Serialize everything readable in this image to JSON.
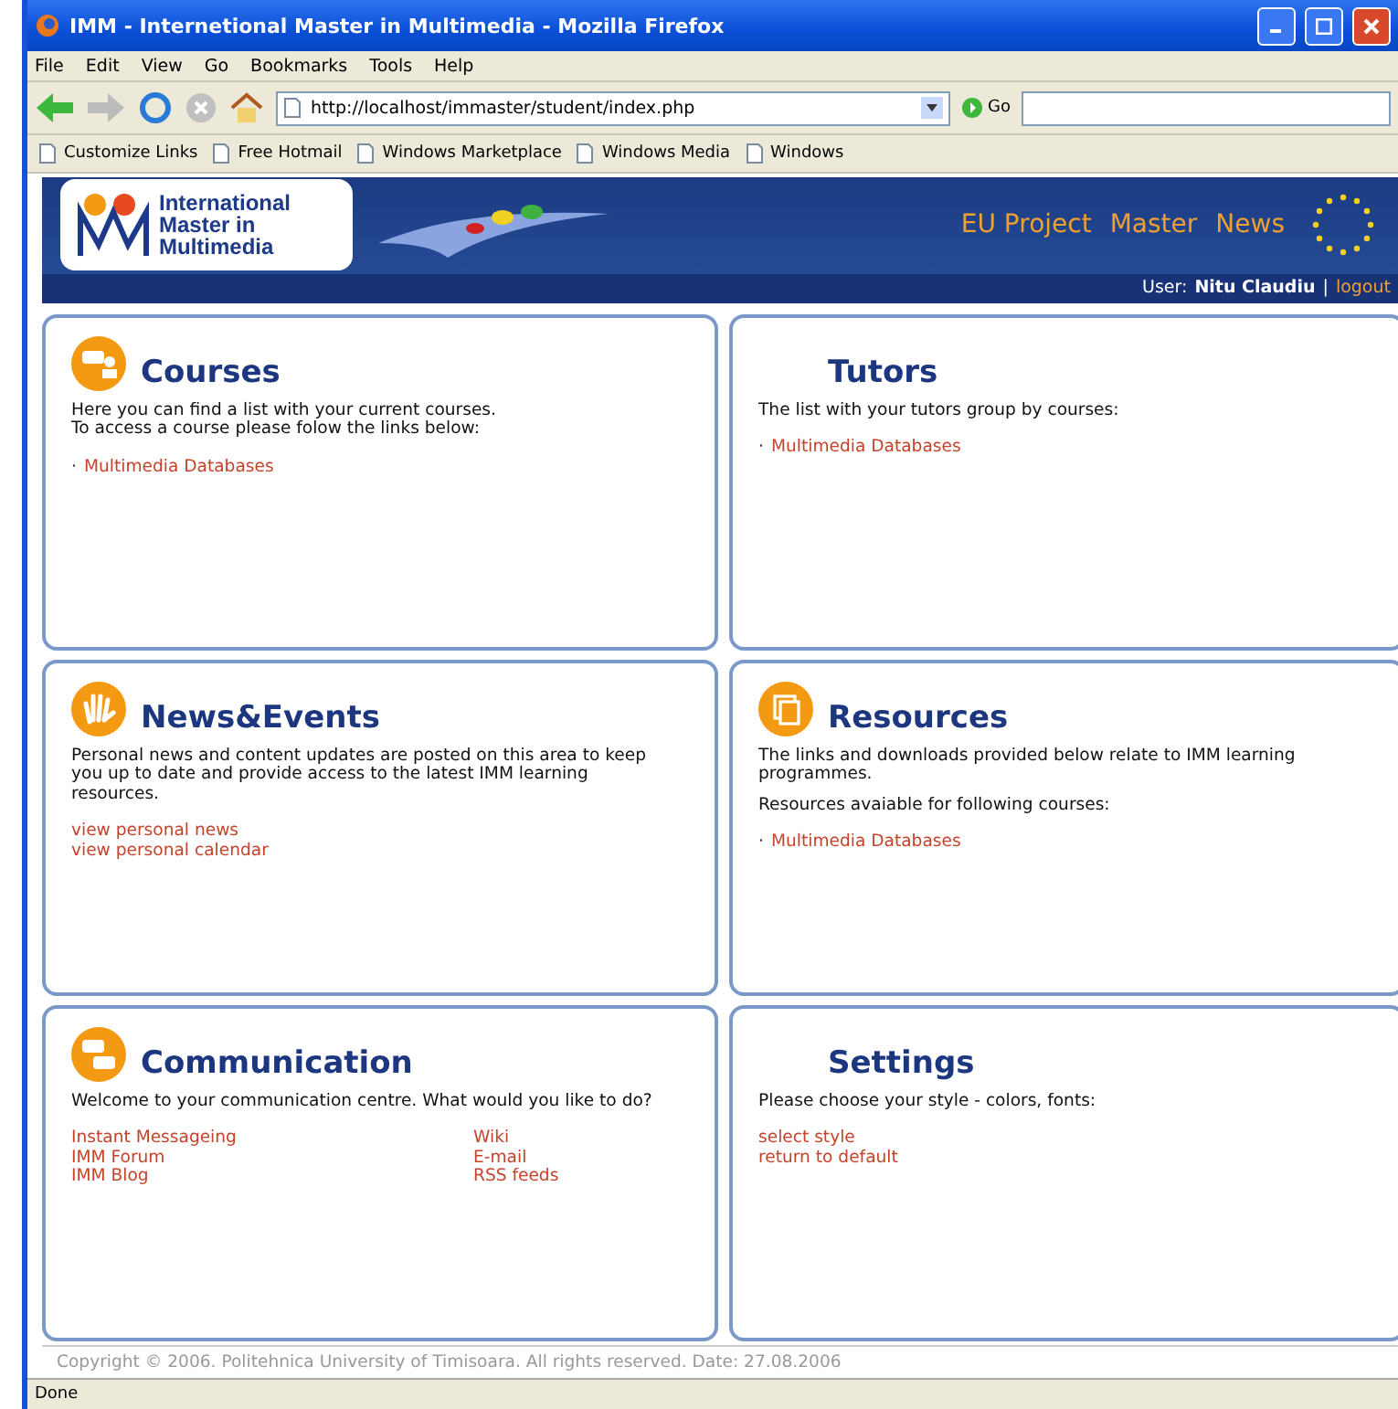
{
  "window": {
    "title": "IMM - Internetional Master in Multimedia - Mozilla Firefox"
  },
  "menu": [
    "File",
    "Edit",
    "View",
    "Go",
    "Bookmarks",
    "Tools",
    "Help"
  ],
  "toolbar": {
    "url": "http://localhost/immaster/student/index.php",
    "go": "Go"
  },
  "bookmarks": [
    "Customize Links",
    "Free Hotmail",
    "Windows Marketplace",
    "Windows Media",
    "Windows"
  ],
  "banner": {
    "logo_lines": [
      "International",
      "Master in",
      "Multimedia"
    ],
    "nav": [
      "EU Project",
      "Master",
      "News"
    ],
    "user_label": "User:",
    "user_name": "Nitu Claudiu",
    "separator": "|",
    "logout": "logout"
  },
  "cards": [
    {
      "kind": "courses",
      "title": "Courses",
      "texts": [
        "Here you can find a list with your current courses.\nTo access a course please folow the links below:"
      ],
      "links": [
        {
          "bullet": "·",
          "label": "Multimedia Databases"
        }
      ]
    },
    {
      "kind": "plain",
      "title": "Tutors",
      "texts": [
        "The list with your tutors group by courses:"
      ],
      "links": [
        {
          "bullet": "·",
          "label": "Multimedia Databases"
        }
      ]
    },
    {
      "kind": "news",
      "title": "News&Events",
      "texts": [
        "Personal news and content updates are posted on this area to keep you up to date and provide access to the latest IMM learning resources."
      ],
      "links": [
        {
          "label": "view personal news"
        },
        {
          "label": "view personal calendar"
        }
      ]
    },
    {
      "kind": "resources",
      "title": "Resources",
      "texts": [
        "The links and downloads provided below relate to IMM learning programmes.",
        "Resources avaiable for following courses:"
      ],
      "links": [
        {
          "bullet": "·",
          "label": "Multimedia Databases"
        }
      ]
    },
    {
      "kind": "communication",
      "title": "Communication",
      "texts": [
        "Welcome to your communication centre. What would you like to do?"
      ],
      "links": [
        {
          "label": "Instant Messageing"
        },
        {
          "label": "IMM Forum"
        },
        {
          "label": "IMM Blog"
        }
      ],
      "links_2": [
        {
          "label": "Wiki"
        },
        {
          "label": "E-mail"
        },
        {
          "label": "RSS feeds"
        }
      ]
    },
    {
      "kind": "plain",
      "title": "Settings",
      "texts": [
        "Please choose your style - colors, fonts:"
      ],
      "links": [
        {
          "label": "select style"
        },
        {
          "label": "return to default"
        }
      ]
    }
  ],
  "footer": "Copyright © 2006. Politehnica University of Timisoara. All rights reserved.  Date: 27.08.2006",
  "status": "Done"
}
